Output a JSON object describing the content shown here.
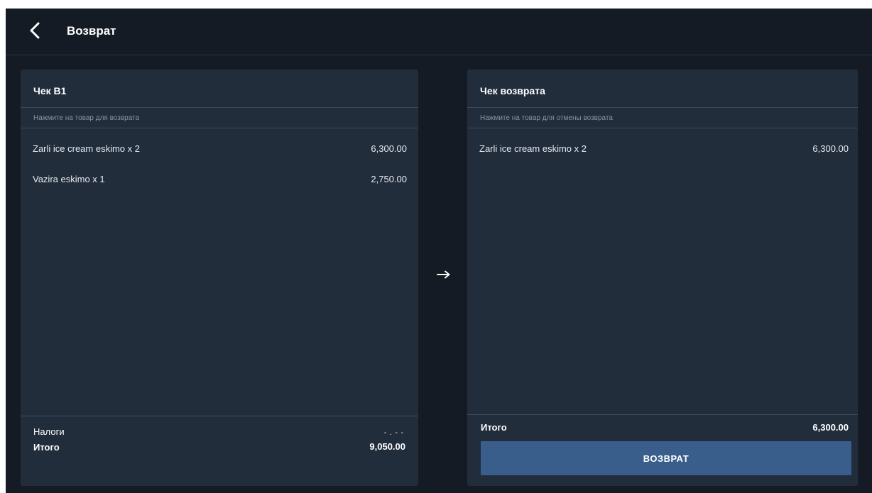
{
  "header": {
    "title": "Возврат",
    "back_icon": "chevron-left-icon"
  },
  "left_panel": {
    "title": "Чек B1",
    "hint": "Нажмите на товар для возврата",
    "items": [
      {
        "name": "Zarli ice cream eskimo x 2",
        "price": "6,300.00"
      },
      {
        "name": "Vazira eskimo x 1",
        "price": "2,750.00"
      }
    ],
    "taxes_label": "Налоги",
    "taxes_value": "- . - -",
    "total_label": "Итого",
    "total_value": "9,050.00"
  },
  "transfer_icon": "arrow-right-icon",
  "right_panel": {
    "title": "Чек возврата",
    "hint": "Нажмите на товар для отмены возврата",
    "items": [
      {
        "name": "Zarli ice cream eskimo x 2",
        "price": "6,300.00"
      }
    ],
    "total_label": "Итого",
    "total_value": "6,300.00",
    "return_button": "ВОЗВРАТ"
  },
  "colors": {
    "background": "#141b24",
    "panel": "#222d3c",
    "divider": "#3d4a5b",
    "hint_text": "#8793a3",
    "button": "#3a5e8c",
    "text": "#ffffff"
  }
}
